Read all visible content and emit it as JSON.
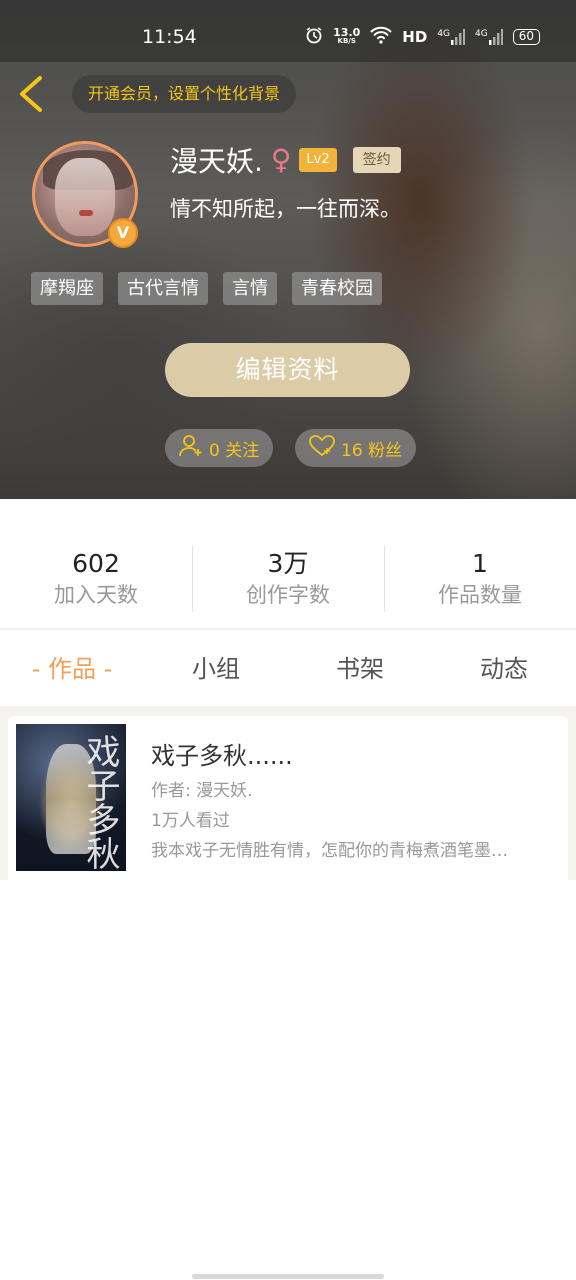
{
  "status_bar": {
    "time": "11:54",
    "speed_value": "13.0",
    "speed_unit": "KB/S",
    "hd": "HD",
    "signal1": "4G",
    "signal2": "4G",
    "battery": "60"
  },
  "header": {
    "vip_prompt": "开通会员，设置个性化背景",
    "username": "漫天妖.",
    "gender_symbol": "♀",
    "level": "Lv2",
    "signed_badge": "签约",
    "bio": "情不知所起，一往而深。",
    "verified_symbol": "V",
    "tags": [
      "摩羯座",
      "古代言情",
      "言情",
      "青春校园"
    ],
    "edit_button": "编辑资料",
    "follow_label": "0 关注",
    "fans_label": "16 粉丝"
  },
  "stats": [
    {
      "value": "602",
      "label": "加入天数"
    },
    {
      "value": "3万",
      "label": "创作字数"
    },
    {
      "value": "1",
      "label": "作品数量"
    }
  ],
  "tabs": [
    {
      "label": "- 作品 -",
      "active": true
    },
    {
      "label": "小组",
      "active": false
    },
    {
      "label": "书架",
      "active": false
    },
    {
      "label": "动态",
      "active": false
    }
  ],
  "works": [
    {
      "title": "戏子多秋......",
      "author": "作者: 漫天妖.",
      "views": "1万人看过",
      "description": "我本戏子无情胜有情，怎配你的青梅煮酒笔墨…",
      "cover_text": "戏子多秋"
    }
  ],
  "colors": {
    "accent_orange": "#f0a05a",
    "gold": "#f5c518",
    "edit_button": "#dbcca7"
  }
}
